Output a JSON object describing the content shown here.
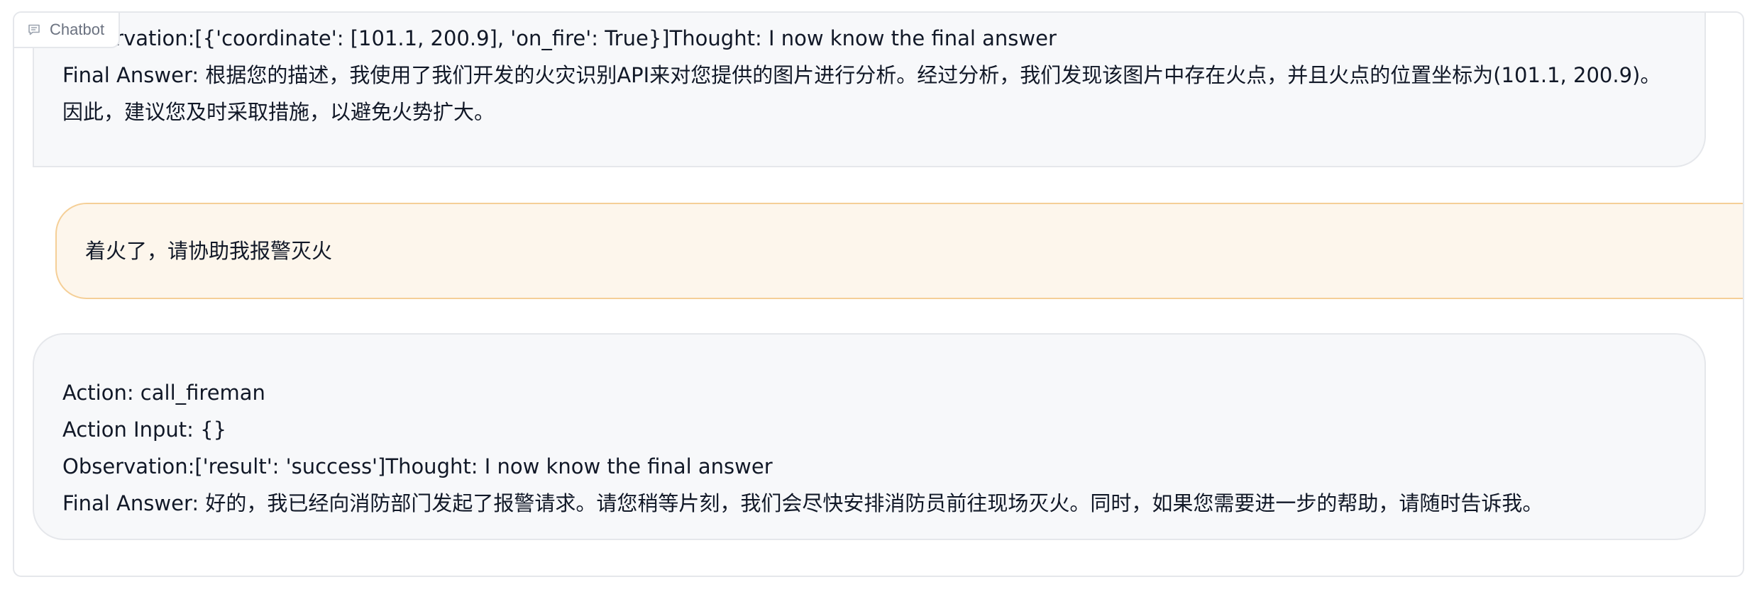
{
  "panel": {
    "label": "Chatbot",
    "label_icon": "chat-bubble-icon"
  },
  "messages": [
    {
      "role": "bot",
      "observation": "Observation:[{'coordinate': [101.1, 200.9], 'on_fire': True}]Thought: I now know the final answer",
      "final_answer": "Final Answer: 根据您的描述，我使用了我们开发的火灾识别API来对您提供的图片进行分析。经过分析，我们发现该图片中存在火点，并且火点的位置坐标为(101.1, 200.9)。因此，建议您及时采取措施，以避免火势扩大。"
    },
    {
      "role": "user",
      "text": "着火了，请协助我报警灭火"
    },
    {
      "role": "bot",
      "action": "Action: call_fireman",
      "action_input": "Action Input: {}",
      "observation": "Observation:['result': 'success']Thought: I now know the final answer",
      "final_answer": "Final Answer: 好的，我已经向消防部门发起了报警请求。请您稍等片刻，我们会尽快安排消防员前往现场灭火。同时，如果您需要进一步的帮助，请随时告诉我。"
    }
  ]
}
